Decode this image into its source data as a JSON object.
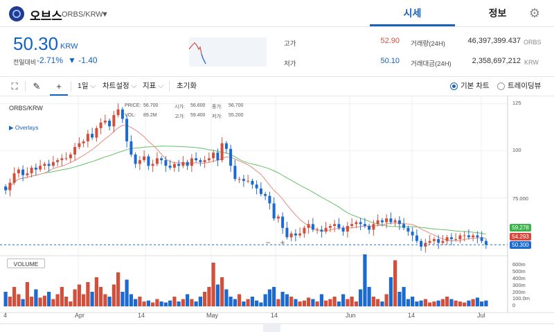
{
  "header": {
    "coin_name": "오브스",
    "pair": "ORBS/KRW",
    "tabs": [
      {
        "label": "시세",
        "active": true
      },
      {
        "label": "정보",
        "active": false
      }
    ]
  },
  "ticker": {
    "price": "50.30",
    "unit": "KRW",
    "change_label": "전일대비",
    "change_pct": "-2.71%",
    "change_abs": "▼ -1.40",
    "high_label": "고가",
    "high": "52.90",
    "low_label": "저가",
    "low": "50.10",
    "volume_label": "거래량(24H)",
    "volume": "46,397,399.437",
    "volume_unit": "ORBS",
    "amount_label": "거래대금(24H)",
    "amount": "2,358,697,212",
    "amount_unit": "KRW"
  },
  "toolbar": {
    "interval": "1일",
    "chart_settings": "차트설정",
    "indicators": "지표",
    "reset": "초기화",
    "basic_chart": "기본 차트",
    "trading_view": "트레이딩뷰"
  },
  "chart_data": {
    "type": "candlestick",
    "symbol": "ORBS/KRW",
    "overlays_label": "Overlays",
    "info": {
      "price": "56.700",
      "open": "56.600",
      "high": "56.700",
      "vol": "89.2M",
      "high2": "59.400",
      "low": "55.200"
    },
    "info_labels": {
      "price": "PRICE:",
      "open": "시가:",
      "close": "종가:",
      "vol": "VOL:",
      "high": "고가:",
      "low": "저가:"
    },
    "price_axis": [
      "125",
      "100",
      "75.000"
    ],
    "ylim": [
      46,
      126
    ],
    "ma_labels": [
      "59.278",
      "54.293"
    ],
    "current_label": "50.300",
    "volume_title": "VOLUME",
    "volume_axis": [
      "600m",
      "500m",
      "400m",
      "300m",
      "200m",
      "100.0m",
      "0"
    ],
    "x_labels": [
      "4",
      "Apr",
      "14",
      "May",
      "14",
      "Jun",
      "14",
      "Jul"
    ],
    "colors": {
      "up": "#d24f3b",
      "down": "#1a6ad0",
      "ma_fast": "#e98a7d",
      "ma_slow": "#63c266",
      "green_tag": "#3bb24a",
      "red_tag": "#d9473b",
      "blue_tag": "#1a6ad0"
    },
    "closes": [
      79,
      83,
      88,
      90,
      87,
      88,
      91,
      90,
      92,
      93,
      92,
      94,
      95,
      96,
      96,
      98,
      102,
      104,
      105,
      109,
      107,
      112,
      115,
      116,
      113,
      119,
      122,
      117,
      105,
      98,
      93,
      95,
      97,
      92,
      93,
      96,
      95,
      92,
      91,
      93,
      92,
      94,
      92,
      96,
      95,
      94,
      95,
      96,
      99,
      95,
      104,
      101,
      92,
      85,
      85,
      84,
      84,
      82,
      80,
      77,
      76,
      72,
      64,
      65,
      59,
      54,
      56,
      55,
      56,
      59,
      61,
      58,
      58,
      57,
      59,
      60,
      61,
      59,
      57,
      60,
      61,
      62,
      61,
      60,
      58,
      61,
      63,
      62,
      64,
      62,
      63,
      61,
      59,
      57,
      55,
      52,
      49,
      51,
      52,
      53,
      51,
      52,
      54,
      53,
      53,
      55,
      55,
      54,
      55,
      54,
      52,
      50
    ]
  }
}
